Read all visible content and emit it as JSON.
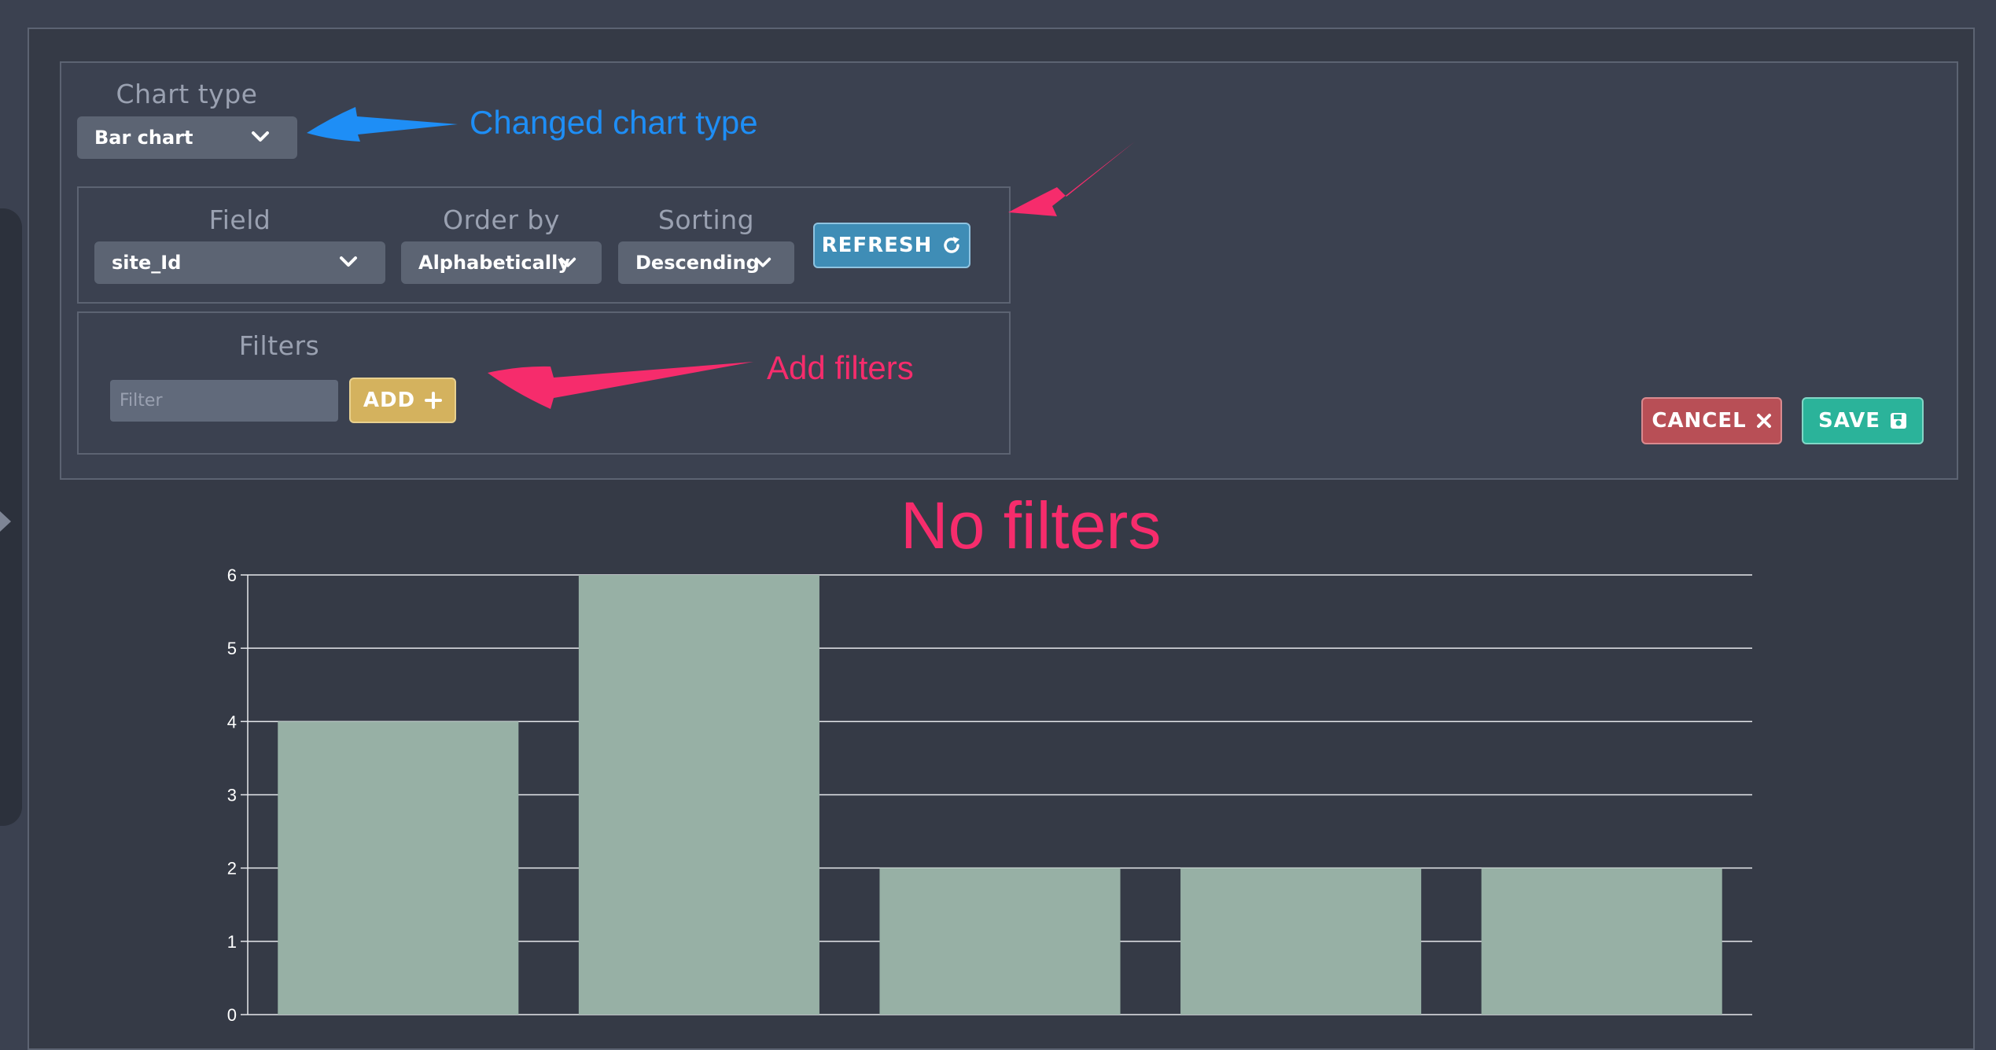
{
  "chart_type": {
    "label": "Chart type",
    "selected": "Bar chart"
  },
  "query": {
    "field_label": "Field",
    "field_value": "site_Id",
    "order_label": "Order by",
    "order_value": "Alphabetically",
    "sorting_label": "Sorting",
    "sorting_value": "Descending",
    "refresh_label": "REFRESH"
  },
  "filters": {
    "label": "Filters",
    "placeholder": "Filter",
    "add_label": "ADD"
  },
  "actions": {
    "cancel_label": "CANCEL",
    "save_label": "SAVE"
  },
  "annotations": {
    "chart_type_note": "Changed chart type",
    "filters_note": "Add filters",
    "chart_note": "No filters"
  },
  "colors": {
    "background": "#3b4150",
    "bar": "#97b0a5",
    "refresh": "#3f8db6",
    "add": "#d4b25e",
    "cancel": "#b84f56",
    "save": "#2bb39a",
    "annotation_pink": "#f62c6c",
    "annotation_blue": "#1e8ef6"
  },
  "chart_data": {
    "type": "bar",
    "categories": [
      "",
      "",
      "",
      "",
      ""
    ],
    "values": [
      4,
      6,
      2,
      2,
      2
    ],
    "ylim": [
      0,
      6
    ],
    "yticks": [
      0,
      1,
      2,
      3,
      4,
      5,
      6
    ],
    "grid": true
  }
}
